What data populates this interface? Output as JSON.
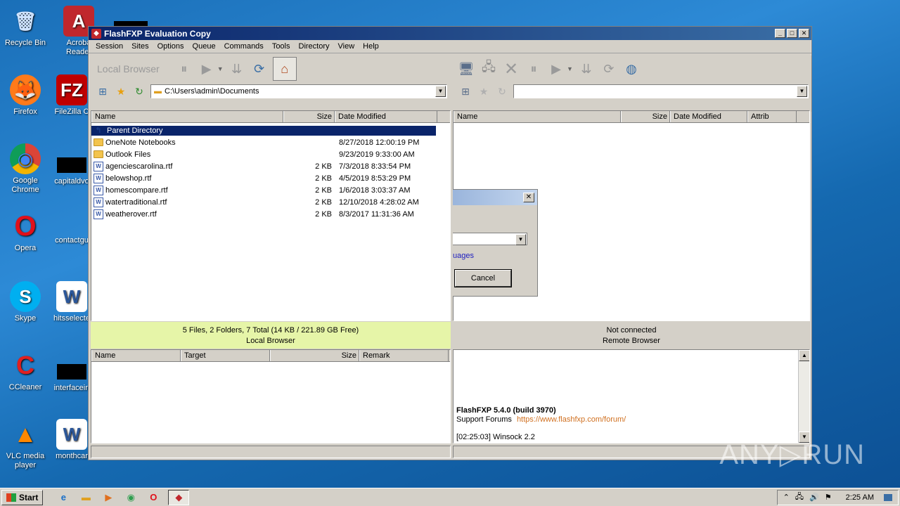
{
  "desktop": {
    "icons": [
      {
        "label": "Recycle Bin",
        "glyph": "🗑"
      },
      {
        "label": "Acroba\nReader",
        "glyph": "A"
      },
      {
        "label": "Firefox",
        "glyph": "🦊"
      },
      {
        "label": "FileZilla C",
        "glyph": "FZ"
      },
      {
        "label": "Google\nChrome",
        "glyph": "◉"
      },
      {
        "label": "capitaldvo",
        "glyph": ""
      },
      {
        "label": "Opera",
        "glyph": "O"
      },
      {
        "label": "contactgu",
        "glyph": ""
      },
      {
        "label": "Skype",
        "glyph": "S"
      },
      {
        "label": "hitsselecte",
        "glyph": "W"
      },
      {
        "label": "CCleaner",
        "glyph": "C"
      },
      {
        "label": "interfacein",
        "glyph": ""
      },
      {
        "label": "VLC media\nplayer",
        "glyph": "▲"
      },
      {
        "label": "monthcar",
        "glyph": "W"
      }
    ]
  },
  "window": {
    "title": "FlashFXP Evaluation Copy",
    "controls": {
      "minimize": "_",
      "maximize": "□",
      "close": "✕"
    }
  },
  "menu": [
    "Session",
    "Sites",
    "Options",
    "Queue",
    "Commands",
    "Tools",
    "Directory",
    "View",
    "Help"
  ],
  "local": {
    "toolbar_label": "Local Browser",
    "path": "C:\\Users\\admin\\Documents",
    "columns": [
      "Name",
      "Size",
      "Date Modified"
    ],
    "rows": [
      {
        "name": "Parent Directory",
        "size": "",
        "date": "",
        "type": "up",
        "selected": true
      },
      {
        "name": "OneNote Notebooks",
        "size": "",
        "date": "8/27/2018 12:00:19 PM",
        "type": "folder"
      },
      {
        "name": "Outlook Files",
        "size": "",
        "date": "9/23/2019 9:33:00 AM",
        "type": "folder"
      },
      {
        "name": "agenciescarolina.rtf",
        "size": "2 KB",
        "date": "7/3/2018 8:33:54 PM",
        "type": "file"
      },
      {
        "name": "belowshop.rtf",
        "size": "2 KB",
        "date": "4/5/2019 8:53:29 PM",
        "type": "file"
      },
      {
        "name": "homescompare.rtf",
        "size": "2 KB",
        "date": "1/6/2018 3:03:37 AM",
        "type": "file"
      },
      {
        "name": "watertraditional.rtf",
        "size": "2 KB",
        "date": "12/10/2018 4:28:02 AM",
        "type": "file"
      },
      {
        "name": "weatherover.rtf",
        "size": "2 KB",
        "date": "8/3/2017 11:31:36 AM",
        "type": "file"
      }
    ],
    "status_line1": "5 Files, 2 Folders, 7 Total (14 KB / 221.89 GB Free)",
    "status_line2": "Local Browser"
  },
  "remote": {
    "path": "",
    "columns": [
      "Name",
      "Size",
      "Date Modified",
      "Attrib"
    ],
    "status_line1": "Not connected",
    "status_line2": "Remote Browser"
  },
  "queue": {
    "columns": [
      "Name",
      "Target",
      "Size",
      "Remark"
    ]
  },
  "log": {
    "version": "FlashFXP 5.4.0 (build 3970)",
    "support_label": "Support Forums",
    "support_url": "https://www.flashfxp.com/forum/",
    "line3": "[02:25:03]  Winsock 2.2"
  },
  "dialog": {
    "link_text": "uages",
    "cancel_label": "Cancel",
    "close": "✕"
  },
  "taskbar": {
    "start_label": "Start",
    "clock": "2:25 AM"
  },
  "watermark": "ANY▷RUN",
  "colors": {
    "status_local_bg": "#e6f5a8",
    "title_bar": "#0a246a",
    "selection": "#0a246a"
  }
}
